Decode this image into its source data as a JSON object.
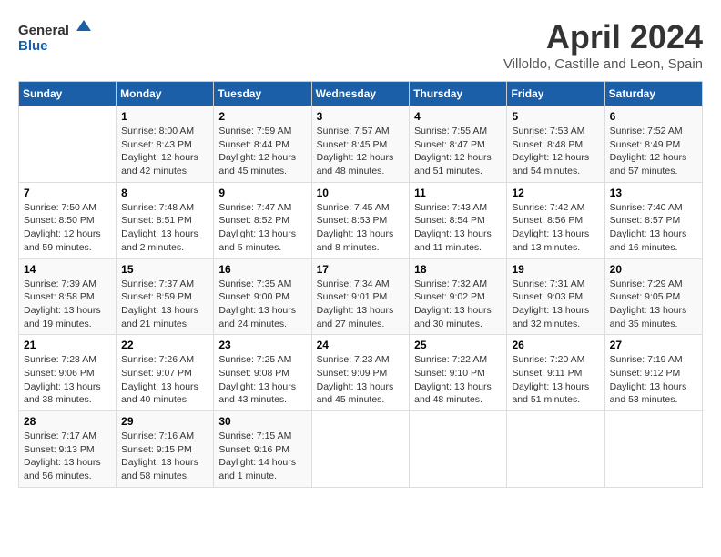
{
  "header": {
    "logo_general": "General",
    "logo_blue": "Blue",
    "month_title": "April 2024",
    "subtitle": "Villoldo, Castille and Leon, Spain"
  },
  "weekdays": [
    "Sunday",
    "Monday",
    "Tuesday",
    "Wednesday",
    "Thursday",
    "Friday",
    "Saturday"
  ],
  "weeks": [
    [
      {
        "day": "",
        "info": ""
      },
      {
        "day": "1",
        "info": "Sunrise: 8:00 AM\nSunset: 8:43 PM\nDaylight: 12 hours\nand 42 minutes."
      },
      {
        "day": "2",
        "info": "Sunrise: 7:59 AM\nSunset: 8:44 PM\nDaylight: 12 hours\nand 45 minutes."
      },
      {
        "day": "3",
        "info": "Sunrise: 7:57 AM\nSunset: 8:45 PM\nDaylight: 12 hours\nand 48 minutes."
      },
      {
        "day": "4",
        "info": "Sunrise: 7:55 AM\nSunset: 8:47 PM\nDaylight: 12 hours\nand 51 minutes."
      },
      {
        "day": "5",
        "info": "Sunrise: 7:53 AM\nSunset: 8:48 PM\nDaylight: 12 hours\nand 54 minutes."
      },
      {
        "day": "6",
        "info": "Sunrise: 7:52 AM\nSunset: 8:49 PM\nDaylight: 12 hours\nand 57 minutes."
      }
    ],
    [
      {
        "day": "7",
        "info": "Sunrise: 7:50 AM\nSunset: 8:50 PM\nDaylight: 12 hours\nand 59 minutes."
      },
      {
        "day": "8",
        "info": "Sunrise: 7:48 AM\nSunset: 8:51 PM\nDaylight: 13 hours\nand 2 minutes."
      },
      {
        "day": "9",
        "info": "Sunrise: 7:47 AM\nSunset: 8:52 PM\nDaylight: 13 hours\nand 5 minutes."
      },
      {
        "day": "10",
        "info": "Sunrise: 7:45 AM\nSunset: 8:53 PM\nDaylight: 13 hours\nand 8 minutes."
      },
      {
        "day": "11",
        "info": "Sunrise: 7:43 AM\nSunset: 8:54 PM\nDaylight: 13 hours\nand 11 minutes."
      },
      {
        "day": "12",
        "info": "Sunrise: 7:42 AM\nSunset: 8:56 PM\nDaylight: 13 hours\nand 13 minutes."
      },
      {
        "day": "13",
        "info": "Sunrise: 7:40 AM\nSunset: 8:57 PM\nDaylight: 13 hours\nand 16 minutes."
      }
    ],
    [
      {
        "day": "14",
        "info": "Sunrise: 7:39 AM\nSunset: 8:58 PM\nDaylight: 13 hours\nand 19 minutes."
      },
      {
        "day": "15",
        "info": "Sunrise: 7:37 AM\nSunset: 8:59 PM\nDaylight: 13 hours\nand 21 minutes."
      },
      {
        "day": "16",
        "info": "Sunrise: 7:35 AM\nSunset: 9:00 PM\nDaylight: 13 hours\nand 24 minutes."
      },
      {
        "day": "17",
        "info": "Sunrise: 7:34 AM\nSunset: 9:01 PM\nDaylight: 13 hours\nand 27 minutes."
      },
      {
        "day": "18",
        "info": "Sunrise: 7:32 AM\nSunset: 9:02 PM\nDaylight: 13 hours\nand 30 minutes."
      },
      {
        "day": "19",
        "info": "Sunrise: 7:31 AM\nSunset: 9:03 PM\nDaylight: 13 hours\nand 32 minutes."
      },
      {
        "day": "20",
        "info": "Sunrise: 7:29 AM\nSunset: 9:05 PM\nDaylight: 13 hours\nand 35 minutes."
      }
    ],
    [
      {
        "day": "21",
        "info": "Sunrise: 7:28 AM\nSunset: 9:06 PM\nDaylight: 13 hours\nand 38 minutes."
      },
      {
        "day": "22",
        "info": "Sunrise: 7:26 AM\nSunset: 9:07 PM\nDaylight: 13 hours\nand 40 minutes."
      },
      {
        "day": "23",
        "info": "Sunrise: 7:25 AM\nSunset: 9:08 PM\nDaylight: 13 hours\nand 43 minutes."
      },
      {
        "day": "24",
        "info": "Sunrise: 7:23 AM\nSunset: 9:09 PM\nDaylight: 13 hours\nand 45 minutes."
      },
      {
        "day": "25",
        "info": "Sunrise: 7:22 AM\nSunset: 9:10 PM\nDaylight: 13 hours\nand 48 minutes."
      },
      {
        "day": "26",
        "info": "Sunrise: 7:20 AM\nSunset: 9:11 PM\nDaylight: 13 hours\nand 51 minutes."
      },
      {
        "day": "27",
        "info": "Sunrise: 7:19 AM\nSunset: 9:12 PM\nDaylight: 13 hours\nand 53 minutes."
      }
    ],
    [
      {
        "day": "28",
        "info": "Sunrise: 7:17 AM\nSunset: 9:13 PM\nDaylight: 13 hours\nand 56 minutes."
      },
      {
        "day": "29",
        "info": "Sunrise: 7:16 AM\nSunset: 9:15 PM\nDaylight: 13 hours\nand 58 minutes."
      },
      {
        "day": "30",
        "info": "Sunrise: 7:15 AM\nSunset: 9:16 PM\nDaylight: 14 hours\nand 1 minute."
      },
      {
        "day": "",
        "info": ""
      },
      {
        "day": "",
        "info": ""
      },
      {
        "day": "",
        "info": ""
      },
      {
        "day": "",
        "info": ""
      }
    ]
  ]
}
